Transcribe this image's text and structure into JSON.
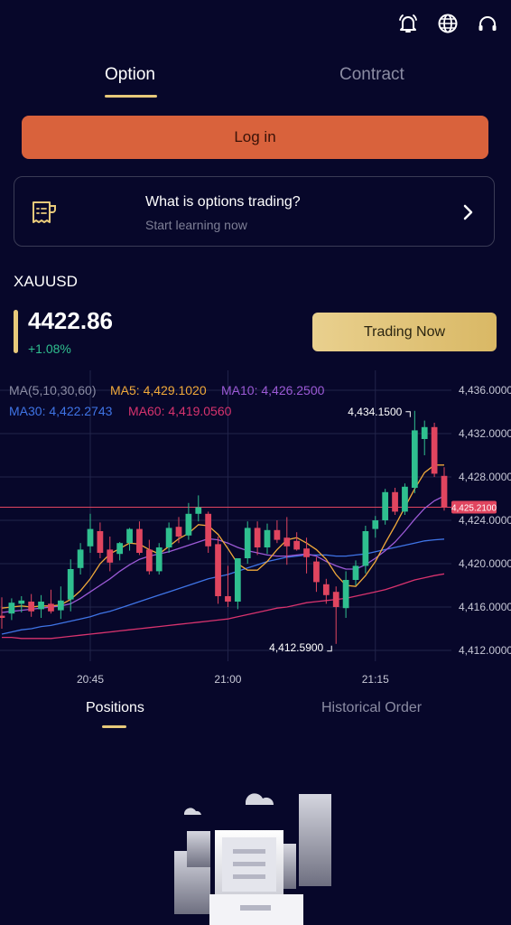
{
  "header": {
    "icons": [
      "bell-icon",
      "globe-icon",
      "headset-icon"
    ]
  },
  "tabs": {
    "option": "Option",
    "contract": "Contract"
  },
  "login_label": "Log in",
  "learn": {
    "title": "What is options trading?",
    "subtitle": "Start learning now"
  },
  "market": {
    "symbol": "XAUUSD",
    "price": "4422.86",
    "change": "+1.08%",
    "trade_label": "Trading Now"
  },
  "chart_data": {
    "type": "candlestick",
    "indicators": {
      "header": "MA(5,10,30,60)",
      "ma5": "MA5: 4,429.1020",
      "ma10": "MA10: 4,426.2500",
      "ma30": "MA30: 4,422.2743",
      "ma60": "MA60: 4,419.0560"
    },
    "y_ticks": [
      "4,436.0000",
      "4,432.0000",
      "4,428.0000",
      "4,424.0000",
      "4,420.0000",
      "4,416.0000",
      "4,412.0000"
    ],
    "ylim": [
      4411,
      4437
    ],
    "x_ticks": [
      "20:45",
      "21:00",
      "21:15"
    ],
    "high_label": "4,434.1500",
    "low_label": "4,412.5900",
    "current_price_label": "4,425.2100",
    "current_price": 4425.21,
    "colors": {
      "up": "#2fbf8f",
      "down": "#e0455f",
      "ma5": "#f0a93a",
      "ma10": "#9c5ad6",
      "ma30": "#3f74e6",
      "ma60": "#d8336e"
    },
    "candles": [
      {
        "o": 4415.2,
        "h": 4416.9,
        "l": 4414.0,
        "c": 4415.0
      },
      {
        "o": 4415.4,
        "h": 4416.8,
        "l": 4414.8,
        "c": 4416.4
      },
      {
        "o": 4416.3,
        "h": 4417.0,
        "l": 4415.5,
        "c": 4416.6
      },
      {
        "o": 4416.5,
        "h": 4417.2,
        "l": 4415.1,
        "c": 4415.6
      },
      {
        "o": 4415.8,
        "h": 4417.1,
        "l": 4415.0,
        "c": 4416.5
      },
      {
        "o": 4416.3,
        "h": 4417.6,
        "l": 4415.4,
        "c": 4415.6
      },
      {
        "o": 4415.7,
        "h": 4417.9,
        "l": 4414.9,
        "c": 4416.6
      },
      {
        "o": 4416.7,
        "h": 4420.4,
        "l": 4415.6,
        "c": 4419.5
      },
      {
        "o": 4419.6,
        "h": 4421.9,
        "l": 4419.0,
        "c": 4421.3
      },
      {
        "o": 4421.6,
        "h": 4424.6,
        "l": 4421.0,
        "c": 4423.2
      },
      {
        "o": 4423.0,
        "h": 4423.8,
        "l": 4420.5,
        "c": 4421.0
      },
      {
        "o": 4421.3,
        "h": 4422.5,
        "l": 4419.3,
        "c": 4420.1
      },
      {
        "o": 4420.9,
        "h": 4422.0,
        "l": 4420.3,
        "c": 4421.9
      },
      {
        "o": 4421.9,
        "h": 4423.3,
        "l": 4421.2,
        "c": 4423.2
      },
      {
        "o": 4423.2,
        "h": 4423.9,
        "l": 4420.8,
        "c": 4421.0
      },
      {
        "o": 4421.3,
        "h": 4422.2,
        "l": 4419.0,
        "c": 4419.3
      },
      {
        "o": 4419.3,
        "h": 4421.9,
        "l": 4419.0,
        "c": 4421.5
      },
      {
        "o": 4421.5,
        "h": 4423.8,
        "l": 4421.0,
        "c": 4423.3
      },
      {
        "o": 4423.4,
        "h": 4424.3,
        "l": 4421.9,
        "c": 4422.5
      },
      {
        "o": 4422.6,
        "h": 4425.6,
        "l": 4422.2,
        "c": 4424.6
      },
      {
        "o": 4424.6,
        "h": 4426.3,
        "l": 4423.9,
        "c": 4425.2
      },
      {
        "o": 4424.6,
        "h": 4424.8,
        "l": 4421.0,
        "c": 4421.6
      },
      {
        "o": 4421.8,
        "h": 4422.5,
        "l": 4416.3,
        "c": 4417.0
      },
      {
        "o": 4417.0,
        "h": 4419.8,
        "l": 4416.0,
        "c": 4416.5
      },
      {
        "o": 4416.5,
        "h": 4420.5,
        "l": 4415.8,
        "c": 4420.5
      },
      {
        "o": 4420.5,
        "h": 4423.9,
        "l": 4420.0,
        "c": 4423.3
      },
      {
        "o": 4423.3,
        "h": 4423.9,
        "l": 4420.8,
        "c": 4421.5
      },
      {
        "o": 4421.5,
        "h": 4423.7,
        "l": 4420.9,
        "c": 4423.1
      },
      {
        "o": 4423.1,
        "h": 4424.0,
        "l": 4421.9,
        "c": 4422.2
      },
      {
        "o": 4422.4,
        "h": 4424.3,
        "l": 4419.9,
        "c": 4421.6
      },
      {
        "o": 4422.1,
        "h": 4422.9,
        "l": 4421.2,
        "c": 4421.3
      },
      {
        "o": 4421.4,
        "h": 4422.4,
        "l": 4419.1,
        "c": 4420.6
      },
      {
        "o": 4420.2,
        "h": 4420.6,
        "l": 4417.4,
        "c": 4418.3
      },
      {
        "o": 4418.1,
        "h": 4418.6,
        "l": 4416.3,
        "c": 4417.1
      },
      {
        "o": 4417.4,
        "h": 4417.9,
        "l": 4412.6,
        "c": 4416.0
      },
      {
        "o": 4415.9,
        "h": 4419.3,
        "l": 4415.0,
        "c": 4418.5
      },
      {
        "o": 4418.5,
        "h": 4420.3,
        "l": 4418.0,
        "c": 4419.8
      },
      {
        "o": 4419.8,
        "h": 4423.5,
        "l": 4419.1,
        "c": 4423.0
      },
      {
        "o": 4423.2,
        "h": 4424.4,
        "l": 4422.4,
        "c": 4424.0
      },
      {
        "o": 4424.0,
        "h": 4426.9,
        "l": 4423.6,
        "c": 4426.6
      },
      {
        "o": 4426.6,
        "h": 4427.0,
        "l": 4424.5,
        "c": 4424.8
      },
      {
        "o": 4424.8,
        "h": 4427.4,
        "l": 4424.5,
        "c": 4427.1
      },
      {
        "o": 4427.0,
        "h": 4434.1,
        "l": 4426.5,
        "c": 4432.3
      },
      {
        "o": 4431.5,
        "h": 4433.2,
        "l": 4430.0,
        "c": 4432.6
      },
      {
        "o": 4432.6,
        "h": 4433.0,
        "l": 4428.0,
        "c": 4428.3
      },
      {
        "o": 4428.1,
        "h": 4428.9,
        "l": 4424.9,
        "c": 4425.2
      }
    ],
    "ma5": [
      4415.9,
      4416.0,
      4416.1,
      4416.0,
      4416.1,
      4416.1,
      4416.2,
      4416.7,
      4417.5,
      4418.6,
      4420.0,
      4420.9,
      4421.4,
      4421.9,
      4421.8,
      4421.3,
      4420.9,
      4421.6,
      4422.3,
      4422.8,
      4423.6,
      4423.5,
      4422.7,
      4421.4,
      4420.0,
      4419.4,
      4419.4,
      4420.2,
      4421.3,
      4422.2,
      4422.4,
      4421.9,
      4421.3,
      4420.4,
      4419.0,
      4418.0,
      4417.9,
      4418.9,
      4420.2,
      4421.9,
      4423.5,
      4425.2,
      4426.9,
      4428.4,
      4429.1,
      4429.1
    ],
    "ma10": [
      4415.5,
      4415.6,
      4415.7,
      4415.8,
      4415.9,
      4416.0,
      4416.1,
      4416.3,
      4416.8,
      4417.4,
      4418.0,
      4418.6,
      4419.3,
      4419.9,
      4420.4,
      4420.7,
      4420.9,
      4421.1,
      4421.4,
      4421.7,
      4422.0,
      4422.3,
      4422.2,
      4421.9,
      4421.5,
      4421.2,
      4421.0,
      4420.8,
      4420.7,
      4420.7,
      4420.8,
      4420.9,
      4420.7,
      4420.2,
      4419.8,
      4419.5,
      4419.5,
      4419.9,
      4420.5,
      4421.2,
      4422.0,
      4423.0,
      4424.1,
      4425.1,
      4425.8,
      4426.25
    ],
    "ma30": [
      4413.5,
      4413.7,
      4413.9,
      4414.0,
      4414.2,
      4414.3,
      4414.5,
      4414.7,
      4414.9,
      4415.1,
      4415.4,
      4415.6,
      4415.9,
      4416.2,
      4416.5,
      4416.8,
      4417.1,
      4417.4,
      4417.7,
      4418.0,
      4418.3,
      4418.6,
      4418.8,
      4419.0,
      4419.3,
      4419.6,
      4419.9,
      4420.2,
      4420.4,
      4420.6,
      4420.7,
      4420.8,
      4420.8,
      4420.8,
      4420.7,
      4420.7,
      4420.8,
      4420.9,
      4421.1,
      4421.3,
      4421.5,
      4421.7,
      4421.9,
      4422.1,
      4422.2,
      4422.27
    ],
    "ma60": [
      4413.2,
      4413.2,
      4413.1,
      4413.1,
      4413.1,
      4413.1,
      4413.2,
      4413.3,
      4413.4,
      4413.5,
      4413.6,
      4413.7,
      4413.8,
      4413.9,
      4414.0,
      4414.1,
      4414.2,
      4414.3,
      4414.4,
      4414.5,
      4414.6,
      4414.7,
      4414.8,
      4414.9,
      4415.1,
      4415.3,
      4415.5,
      4415.7,
      4415.9,
      4416.0,
      4416.2,
      4416.4,
      4416.5,
      4416.6,
      4416.7,
      4416.8,
      4417.0,
      4417.2,
      4417.4,
      4417.6,
      4417.9,
      4418.2,
      4418.5,
      4418.7,
      4418.9,
      4419.06
    ]
  },
  "positions_tabs": {
    "positions": "Positions",
    "history": "Historical Order"
  }
}
